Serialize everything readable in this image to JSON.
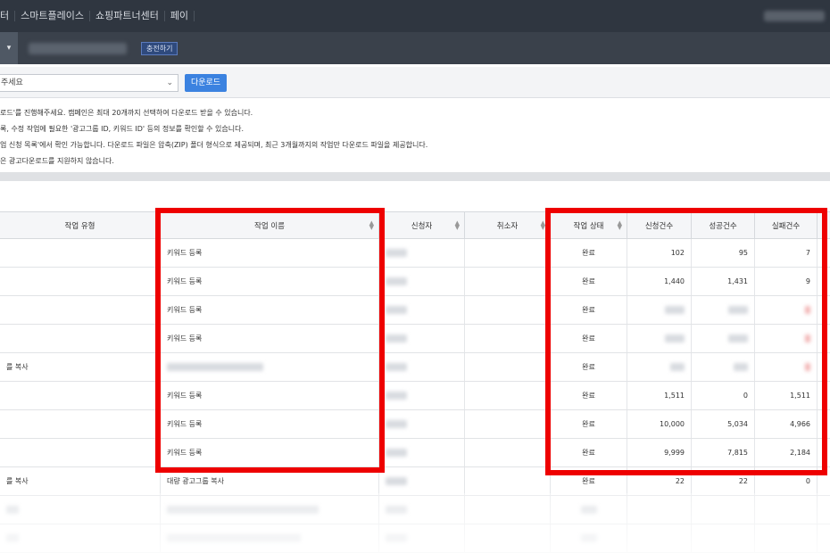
{
  "topnav": {
    "items": [
      "터",
      "스마트플레이스",
      "쇼핑파트너센터",
      "페이"
    ]
  },
  "subbar": {
    "toggle_icon": "▾",
    "charge_label": "충전하기"
  },
  "filter": {
    "select_value": "주세요",
    "download_label": "다운로드"
  },
  "notice": [
    "로드'를 진행해주세요. 캠페인은 최대 20개까지 선택하여 다운로드 받을 수 있습니다.",
    "록, 수정 작업에 필요한 '광고그룹 ID, 키워드 ID' 등의 정보를 확인할 수 있습니다.",
    "업 신청 목록'에서 확인 가능합니다. 다운로드 파일은 압축(ZIP) 폴더 형식으로 제공되며, 최근 3개월까지의 작업만 다운로드 파일을 제공합니다.",
    "은 광고다운로드를 지원하지 않습니다."
  ],
  "table": {
    "headers": [
      "작업 유형",
      "작업 이름",
      "신청자",
      "취소자",
      "작업 상태",
      "신청건수",
      "성공건수",
      "실패건수"
    ],
    "rows": [
      {
        "type": "",
        "name": "키워드 등록",
        "status": "완료",
        "requested": "102",
        "success": "95",
        "failed": "7"
      },
      {
        "type": "",
        "name": "키워드 등록",
        "status": "완료",
        "requested": "1,440",
        "success": "1,431",
        "failed": "9"
      },
      {
        "type": "",
        "name": "키워드 등록",
        "status": "완료",
        "requested": "",
        "success": "",
        "failed": ""
      },
      {
        "type": "",
        "name": "키워드 등록",
        "status": "완료",
        "requested": "",
        "success": "",
        "failed": ""
      },
      {
        "type": "를 복사",
        "name": "",
        "status": "완료",
        "requested": "",
        "success": "",
        "failed": ""
      },
      {
        "type": "",
        "name": "키워드 등록",
        "status": "완료",
        "requested": "1,511",
        "success": "0",
        "failed": "1,511"
      },
      {
        "type": "",
        "name": "키워드 등록",
        "status": "완료",
        "requested": "10,000",
        "success": "5,034",
        "failed": "4,966"
      },
      {
        "type": "",
        "name": "키워드 등록",
        "status": "완료",
        "requested": "9,999",
        "success": "7,815",
        "failed": "2,184"
      },
      {
        "type": "를 복사",
        "name": "대량 광고그룹 복사",
        "status": "완료",
        "requested": "22",
        "success": "22",
        "failed": "0"
      }
    ]
  },
  "colors": {
    "topnav_bg": "#2f3640",
    "subbar_bg": "#3a414b",
    "primary_button": "#3b82e0",
    "highlight_red": "#ee0000"
  }
}
